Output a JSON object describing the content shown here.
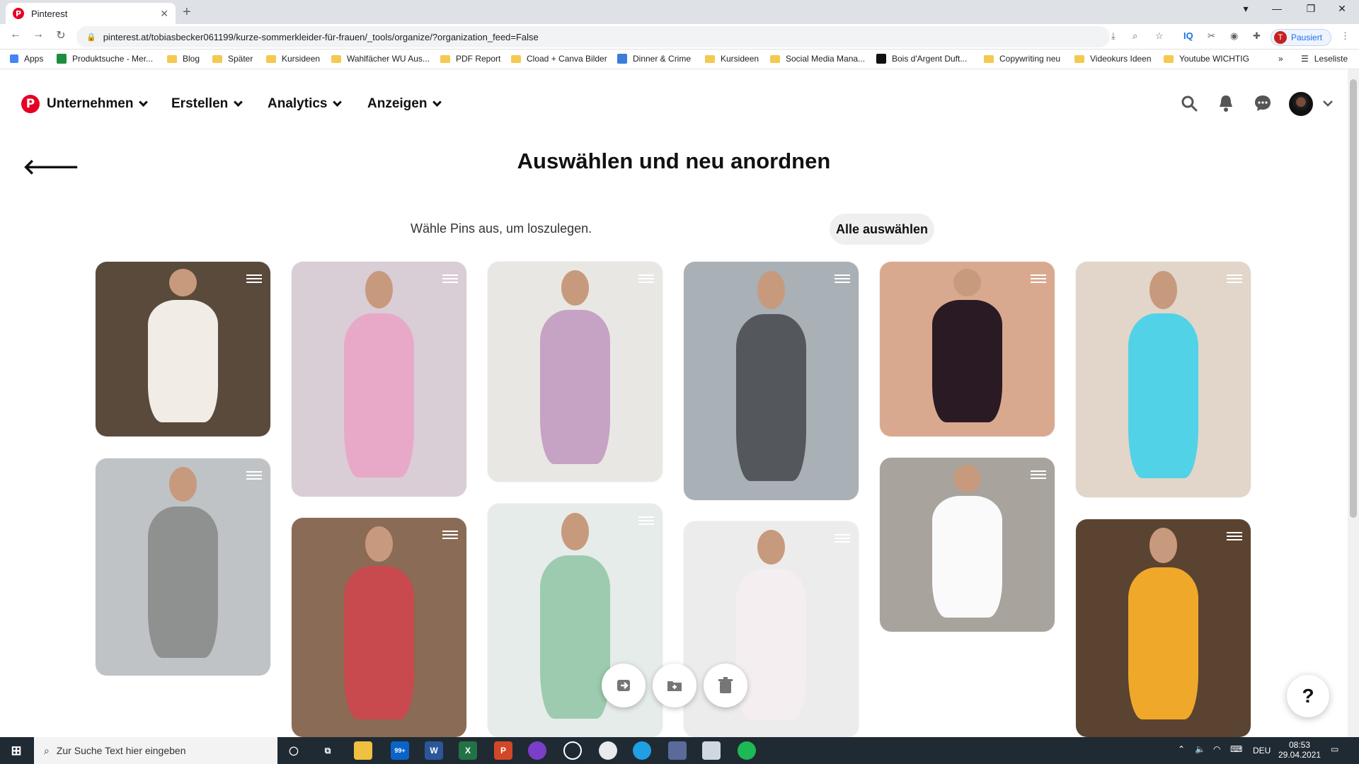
{
  "browser": {
    "tab_title": "Pinterest",
    "url": "pinterest.at/tobiasbecker061199/kurze-sommerkleider-für-frauen/_tools/organize/?organization_feed=False",
    "profile_status": "Pausiert",
    "profile_initial": "T",
    "bookmarks": [
      "Apps",
      "Produktsuche - Mer...",
      "Blog",
      "Später",
      "Kursideen",
      "Wahlfächer WU Aus...",
      "PDF Report",
      "Cload + Canva Bilder",
      "Dinner & Crime",
      "Kursideen",
      "Social Media Mana...",
      "Bois d'Argent Duft...",
      "Copywriting neu",
      "Videokurs Ideen",
      "Youtube WICHTIG"
    ],
    "reading_list": "Leseliste"
  },
  "header": {
    "logo": "P",
    "menus": [
      "Unternehmen",
      "Erstellen",
      "Analytics",
      "Anzeigen"
    ]
  },
  "main": {
    "title": "Auswählen und neu anordnen",
    "hint": "Wähle Pins aus, um loszulegen.",
    "select_all": "Alle auswählen",
    "help": "?"
  },
  "pins": [
    {
      "bg": "#5a4a3c",
      "dress": "#f1ece6"
    },
    {
      "bg": "#bfc3c6",
      "dress": "#8f9090"
    },
    {
      "bg": "#d9cdd6",
      "dress": "#e8a9c9"
    },
    {
      "bg": "#8a6b55",
      "dress": "#c84a4e"
    },
    {
      "bg": "#e9e7e3",
      "dress": "#c6a2c4"
    },
    {
      "bg": "#e6ece9",
      "dress": "#9ccbaf"
    },
    {
      "bg": "#a9b0b6",
      "dress": "#54585c"
    },
    {
      "bg": "#ececec",
      "dress": "#f4eef0"
    },
    {
      "bg": "#d9a98f",
      "dress": "#2a1a24"
    },
    {
      "bg": "#a8a39c",
      "dress": "#fafafa"
    },
    {
      "bg": "#e1d6c9",
      "dress": "#52d2e6"
    },
    {
      "bg": "#5a4330",
      "dress": "#f0a82a"
    }
  ],
  "taskbar": {
    "search_placeholder": "Zur Suche Text hier eingeben",
    "mail_badge": "99+",
    "language": "DEU",
    "time": "08:53",
    "date": "29.04.2021"
  }
}
